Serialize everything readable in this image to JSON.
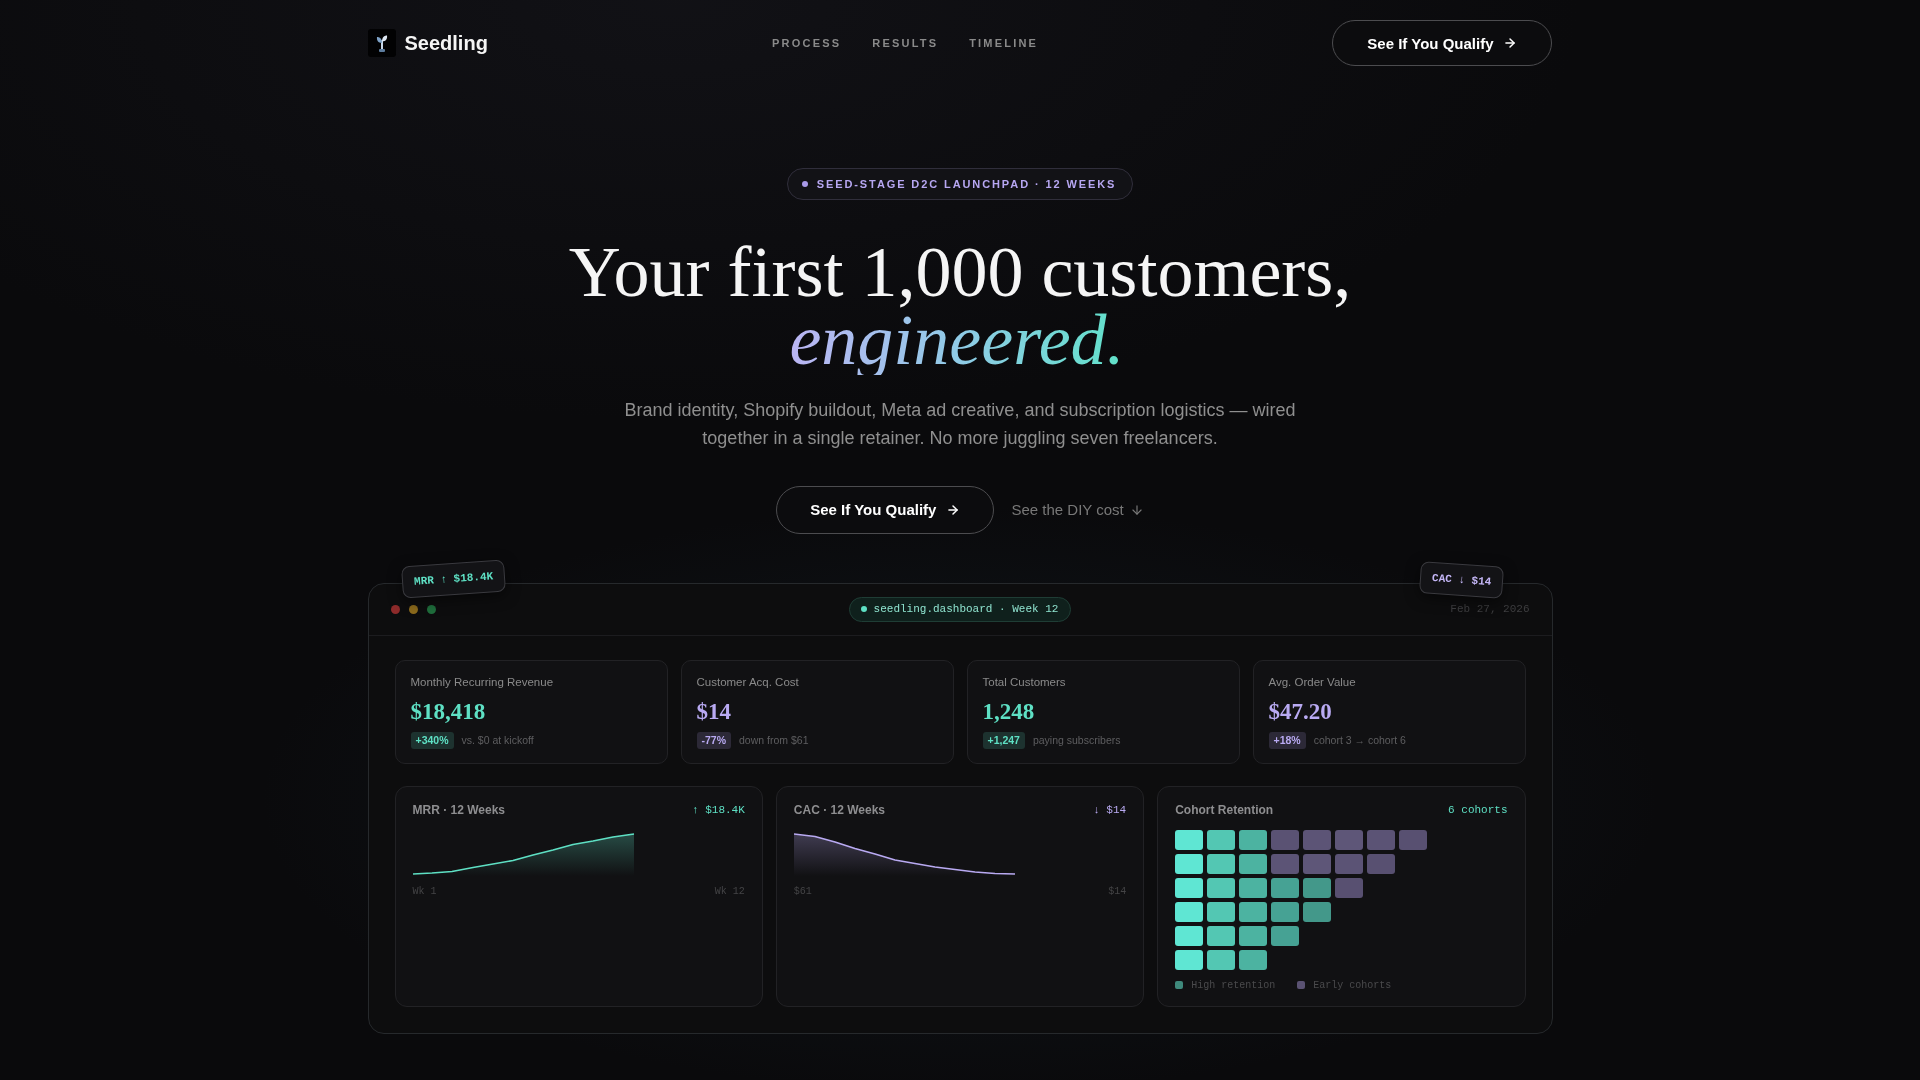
{
  "nav": {
    "brand": "Seedling",
    "links": [
      "PROCESS",
      "RESULTS",
      "TIMELINE"
    ],
    "cta": "See If You Qualify"
  },
  "hero": {
    "badge": "SEED-STAGE D2C LAUNCHPAD · 12 WEEKS",
    "headline": "Your first 1,000 customers,",
    "headline_accent": "engineered.",
    "subtitle": "Brand identity, Shopify buildout, Meta ad creative, and subscription logistics — wired together in a single retainer. No more juggling seven freelancers.",
    "primary_cta": "See If You Qualify",
    "secondary_cta": "See the DIY cost"
  },
  "dashboard": {
    "address": "seedling.dashboard · Week 12",
    "date": "Feb 27, 2026",
    "floating_tags": [
      {
        "text": "MRR ↑ $18.4K",
        "color": "#5ee0c4"
      },
      {
        "text": "CAC ↓ $14",
        "color": "#c4b6f6"
      }
    ],
    "stats": [
      {
        "label": "Monthly Recurring Revenue",
        "value": "$18,418",
        "change": "+340%",
        "note": "vs. $0 at kickoff",
        "color": "#5ee0c4"
      },
      {
        "label": "Customer Acq. Cost",
        "value": "$14",
        "change": "-77%",
        "note": "down from $61",
        "color": "#b9aaf2"
      },
      {
        "label": "Total Customers",
        "value": "1,248",
        "change": "+1,247",
        "note": "paying subscribers",
        "color": "#5ee0c4"
      },
      {
        "label": "Avg. Order Value",
        "value": "$47.20",
        "change": "+18%",
        "note": "cohort 3 → cohort 6",
        "color": "#b9aaf2"
      }
    ],
    "charts": [
      {
        "kind": "rising",
        "title": "MRR · 12 Weeks",
        "reading": "↑ $18.4K",
        "color": "#5ee0c4",
        "start_label": "Wk 1",
        "end_label": "Wk 12"
      },
      {
        "kind": "falling",
        "title": "CAC · 12 Weeks",
        "reading": "↓ $14",
        "color": "#b9aaf2",
        "start_label": "$61",
        "end_label": "$14"
      }
    ],
    "cohort": {
      "title": "Cohort Retention",
      "reading": "6 cohorts",
      "legend": [
        {
          "label": "High retention",
          "color": "#3f8a7c"
        },
        {
          "label": "Early cohorts",
          "color": "#5a5272"
        }
      ]
    }
  }
}
